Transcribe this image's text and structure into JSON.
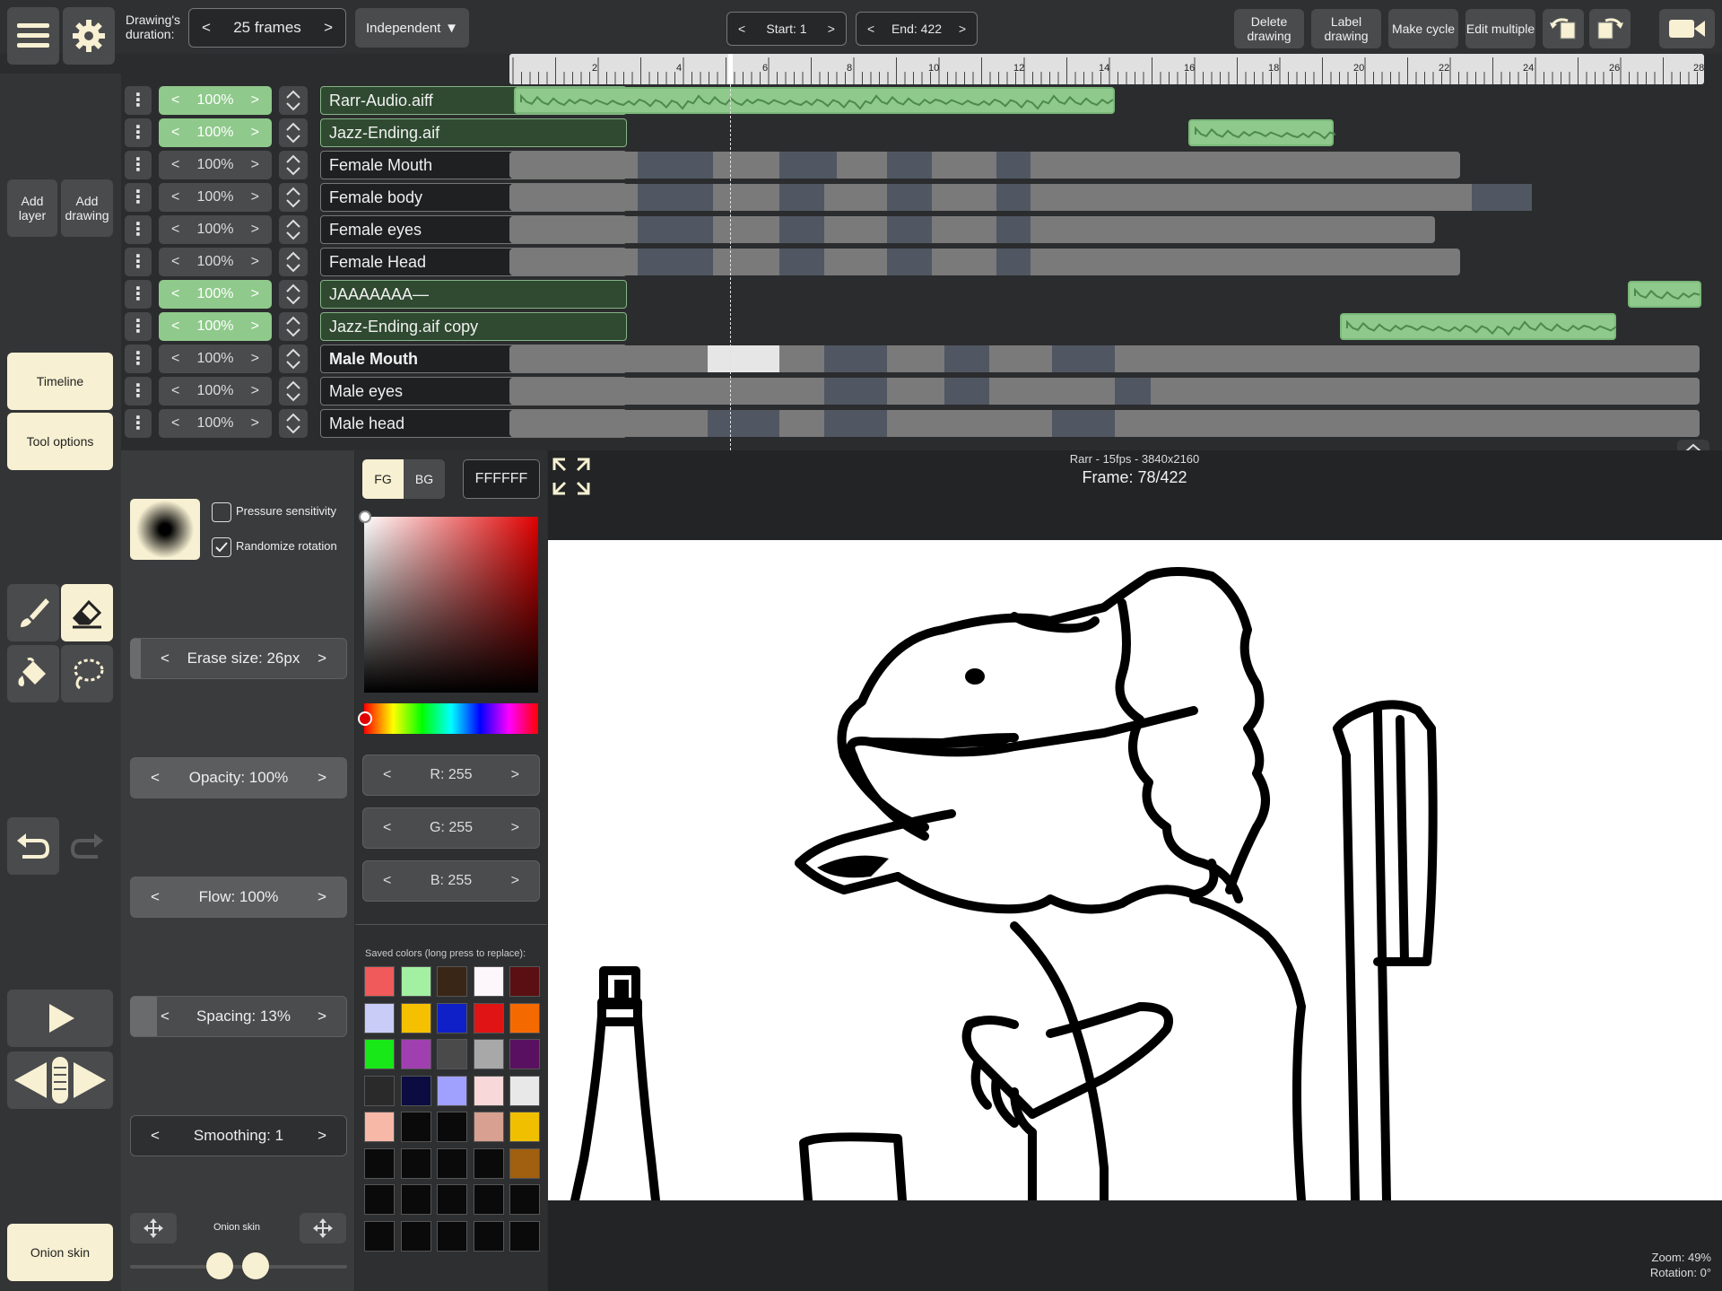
{
  "topbar": {
    "duration_label": "Drawing's duration:",
    "duration_value": "25 frames",
    "mode": "Independent",
    "start": "Start: 1",
    "end": "End: 422",
    "actions": [
      "Delete drawing",
      "Label drawing",
      "Make cycle",
      "Edit multiple"
    ]
  },
  "ruler": {
    "ticks": [
      "2",
      "4",
      "6",
      "8",
      "10",
      "12",
      "14",
      "16",
      "18",
      "20",
      "22",
      "24",
      "26",
      "28"
    ]
  },
  "sidebar": {
    "add_layer": "Add layer",
    "add_drawing": "Add drawing",
    "timeline": "Timeline",
    "tool_options": "Tool options",
    "onion_skin": "Onion skin"
  },
  "layers": [
    {
      "name": "Rarr-Audio.aiff",
      "opacity": "100%",
      "audio": true,
      "bold": false
    },
    {
      "name": "Jazz-Ending.aif",
      "opacity": "100%",
      "audio": true,
      "bold": false
    },
    {
      "name": "Female Mouth",
      "opacity": "100%",
      "audio": false,
      "bold": false
    },
    {
      "name": "Female body",
      "opacity": "100%",
      "audio": false,
      "bold": false
    },
    {
      "name": "Female eyes",
      "opacity": "100%",
      "audio": false,
      "bold": false
    },
    {
      "name": "Female Head",
      "opacity": "100%",
      "audio": false,
      "bold": false
    },
    {
      "name": "JAAAAAAA—",
      "opacity": "100%",
      "audio": true,
      "bold": false
    },
    {
      "name": "Jazz-Ending.aif copy",
      "opacity": "100%",
      "audio": true,
      "bold": false
    },
    {
      "name": "Male Mouth",
      "opacity": "100%",
      "audio": false,
      "bold": true
    },
    {
      "name": "Male eyes",
      "opacity": "100%",
      "audio": false,
      "bold": false
    },
    {
      "name": "Male head",
      "opacity": "100%",
      "audio": false,
      "bold": false
    }
  ],
  "tool": {
    "pressure": "Pressure sensitivity",
    "pressure_checked": false,
    "randomize": "Randomize rotation",
    "randomize_checked": true,
    "erase_size": "Erase size:  26px",
    "opacity": "Opacity:  100%",
    "flow": "Flow:  100%",
    "spacing": "Spacing:  13%",
    "smoothing": "Smoothing:  1",
    "onion_label": "Onion skin"
  },
  "color": {
    "fg": "FG",
    "bg": "BG",
    "hex": "FFFFFF",
    "r": "R: 255",
    "g": "G: 255",
    "b": "B: 255",
    "saved_label": "Saved colors (long press to replace):",
    "saved": [
      "#f05a5a",
      "#a3f0a3",
      "#3a2616",
      "#fdf6fb",
      "#5a0f12",
      "#c8ccf7",
      "#f5c000",
      "#1020c8",
      "#e01414",
      "#f56a00",
      "#18e818",
      "#a040b0",
      "#4a4a4a",
      "#a8a8a8",
      "#5a1060",
      "#2a2a2a",
      "#0c0c40",
      "#a0a0ff",
      "#f8d8d8",
      "#e8e8e8",
      "#f8b8a8",
      "#0a0a0a",
      "#0a0a0a",
      "#d8a090",
      "#f0c000",
      "#0a0a0a",
      "#0a0a0a",
      "#0a0a0a",
      "#0a0a0a",
      "#a06010",
      "#0a0a0a",
      "#0a0a0a",
      "#0a0a0a",
      "#0a0a0a",
      "#0a0a0a",
      "#0a0a0a",
      "#0a0a0a",
      "#0a0a0a",
      "#0a0a0a",
      "#0a0a0a"
    ]
  },
  "canvas": {
    "info": "Rarr - 15fps - 3840x2160",
    "frame": "Frame: 78/422",
    "zoom": "Zoom: 49%",
    "rotation": "Rotation: 0°"
  }
}
